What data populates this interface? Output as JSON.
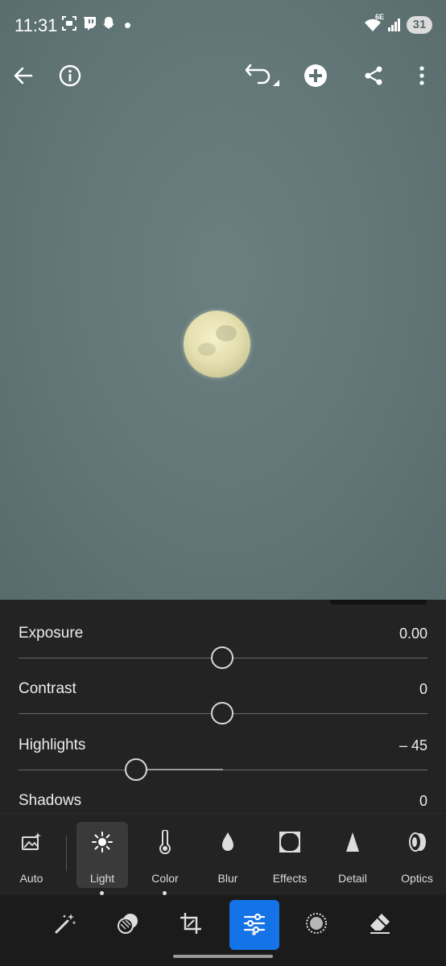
{
  "status_bar": {
    "time": "11:31",
    "icons": [
      "screenshot-icon",
      "twitch-icon",
      "snapchat-icon",
      "notification-dot"
    ],
    "wifi_label": "6E",
    "battery": "31"
  },
  "toolbar": {
    "buttons": [
      "back-arrow-icon",
      "info-icon",
      "undo-icon",
      "add-icon",
      "share-icon",
      "more-vert-icon"
    ]
  },
  "light_panel": {
    "exposure": {
      "label": "Exposure",
      "value": "0.00",
      "level": 0.5
    },
    "contrast": {
      "label": "Contrast",
      "value": "0",
      "level": 0.5
    },
    "highlights": {
      "label": "Highlights",
      "value": "– 45",
      "level": 0.28
    },
    "shadows": {
      "label": "Shadows",
      "value": "0"
    }
  },
  "tool_tabs": [
    {
      "label": "Auto",
      "icon": "auto-icon"
    },
    {
      "label": "Light",
      "icon": "sun-icon",
      "active": true
    },
    {
      "label": "Color",
      "icon": "thermometer-icon"
    },
    {
      "label": "Blur",
      "icon": "drop-icon"
    },
    {
      "label": "Effects",
      "icon": "vignette-icon"
    },
    {
      "label": "Detail",
      "icon": "triangle-icon"
    },
    {
      "label": "Optics",
      "icon": "lens-icon"
    }
  ],
  "bottom_tools": [
    "presets-wand-icon",
    "selective-icon",
    "crop-icon",
    "edit-sliders-icon",
    "heal-icon",
    "eraser-icon"
  ],
  "colors": {
    "accent": "#1473e6",
    "panel_bg": "#232323",
    "photo_bg": "#627677"
  }
}
